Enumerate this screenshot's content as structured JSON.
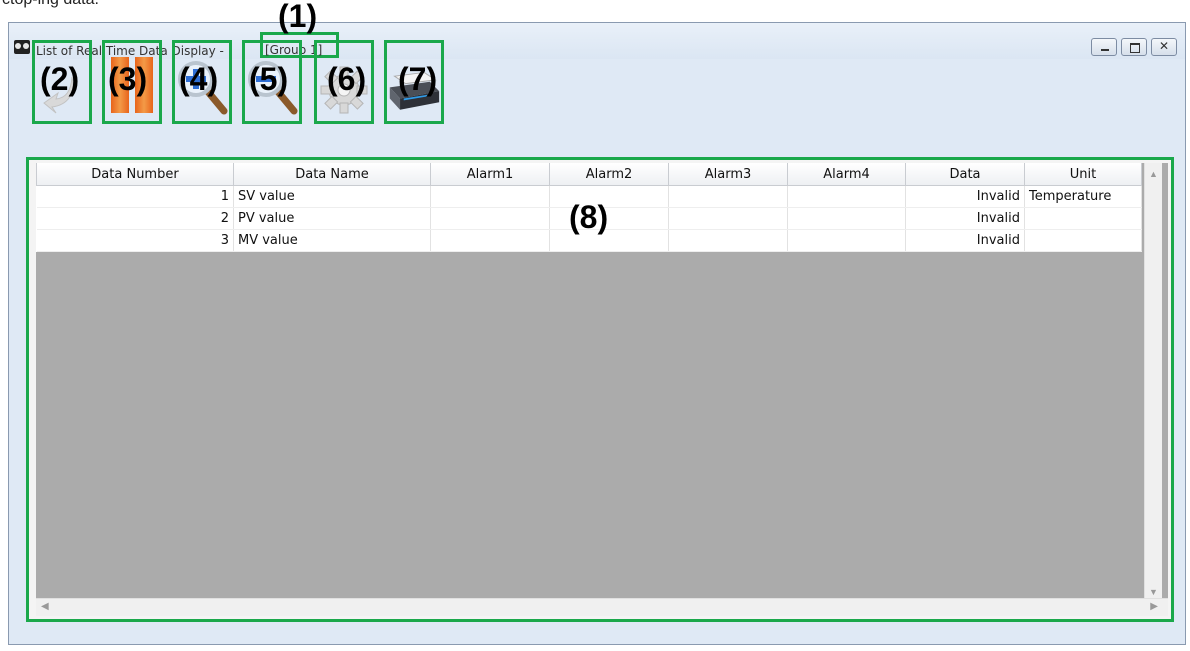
{
  "caption": "ctop-ing data.",
  "window": {
    "title": "List of Real Time Data Display - ",
    "group": "[Group 1]"
  },
  "callouts": [
    "(1)",
    "(2)",
    "(3)",
    "(4)",
    "(5)",
    "(6)",
    "(7)",
    "(8)"
  ],
  "toolbar": [
    {
      "name": "back",
      "icon": "back-arrow-icon"
    },
    {
      "name": "pause",
      "icon": "pause-icon"
    },
    {
      "name": "zoom-in",
      "icon": "zoom-in-icon"
    },
    {
      "name": "zoom-out",
      "icon": "zoom-out-icon"
    },
    {
      "name": "settings",
      "icon": "gear-icon"
    },
    {
      "name": "print",
      "icon": "printer-icon"
    }
  ],
  "table": {
    "columns": [
      "Data Number",
      "Data Name",
      "Alarm1",
      "Alarm2",
      "Alarm3",
      "Alarm4",
      "Data",
      "Unit"
    ],
    "rows": [
      [
        "1",
        "SV value",
        "",
        "",
        "",
        "",
        "Invalid",
        "Temperature"
      ],
      [
        "2",
        "PV value",
        "",
        "",
        "",
        "",
        "Invalid",
        ""
      ],
      [
        "3",
        "MV value",
        "",
        "",
        "",
        "",
        "Invalid",
        ""
      ]
    ]
  },
  "colors": {
    "highlight": "#1aa84b",
    "grid_empty": "#ababab"
  }
}
